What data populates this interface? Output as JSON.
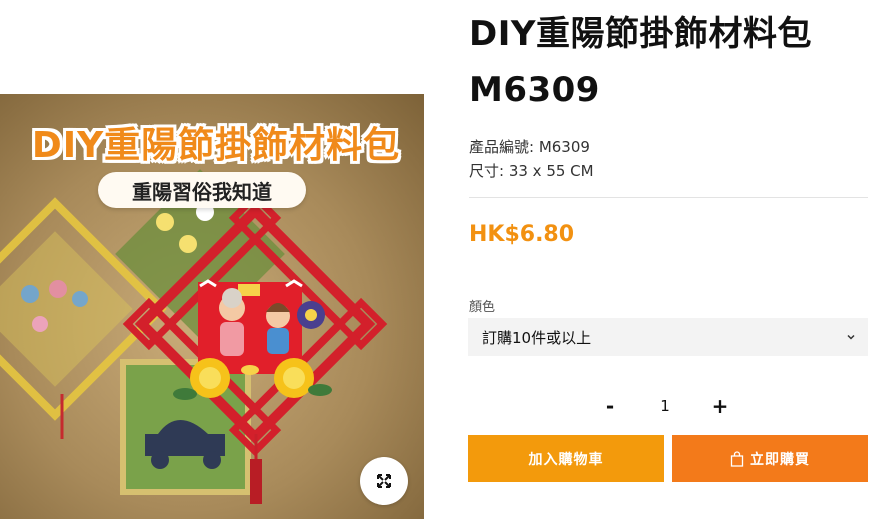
{
  "product": {
    "title": "DIY重陽節掛飾材料包 M6309",
    "code_line": "產品編號: M6309",
    "size_line": "尺寸: 33 x 55 CM",
    "price": "HK$6.80"
  },
  "image": {
    "banner_text": "DIY重陽節掛飾材料包",
    "pill_text": "重陽習俗我知道",
    "zoom_icon": "expand-icon"
  },
  "options": {
    "label": "顏色",
    "selected": "訂購10件或以上"
  },
  "quantity": {
    "minus": "-",
    "value": "1",
    "plus": "+"
  },
  "actions": {
    "add_to_cart": "加入購物車",
    "buy_now": "立即購買",
    "buy_icon": "shopping-bag-icon"
  },
  "colors": {
    "price": "#f29111",
    "cart_button": "#f39a0c",
    "buy_button": "#f37a1a"
  }
}
